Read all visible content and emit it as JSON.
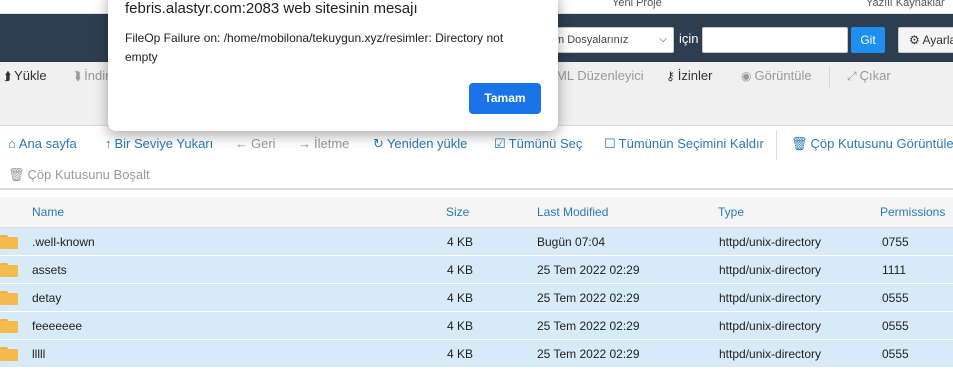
{
  "dialog": {
    "title": "febris.alastyr.com:2083 web sitesinin mesajı",
    "message": "FileOp Failure on: /home/mobilona/tekuygun.xyz/resimler: Directory not empty",
    "ok_label": "Tamam"
  },
  "bookmarks": [
    "Yeni Proje",
    "Yazılı Kaynaklar"
  ],
  "search": {
    "scope_value": "m Dosyalarınız",
    "for_label": "için",
    "query": "",
    "go_label": "Git",
    "settings_label": "Ayarlar"
  },
  "toolbar": {
    "upload": "Yükle",
    "download": "İndir",
    "html_editor": "ML Düzenleyici",
    "permissions": "İzinler",
    "view": "Görüntüle",
    "extract": "Çıkar"
  },
  "nav": {
    "home": "Ana sayfa",
    "up_one_level": "Bir Seviye Yukarı",
    "back": "Geri",
    "forward": "İletme",
    "reload": "Yeniden yükle",
    "select_all": "Tümünü Seç",
    "unselect_all": "Tümünün Seçimini Kaldır",
    "view_trash": "Çöp Kutusunu Görüntüle",
    "empty_trash": "Çöp Kutusunu Boşalt"
  },
  "table": {
    "headers": [
      "Name",
      "Size",
      "Last Modified",
      "Type",
      "Permissions"
    ],
    "rows": [
      {
        "name": ".well-known",
        "size": "4 KB",
        "modified": "Bugün 07:04",
        "type": "httpd/unix-directory",
        "perms": "0755"
      },
      {
        "name": "assets",
        "size": "4 KB",
        "modified": "25 Tem 2022 02:29",
        "type": "httpd/unix-directory",
        "perms": "1111"
      },
      {
        "name": "detay",
        "size": "4 KB",
        "modified": "25 Tem 2022 02:29",
        "type": "httpd/unix-directory",
        "perms": "0555"
      },
      {
        "name": "feeeeeee",
        "size": "4 KB",
        "modified": "25 Tem 2022 02:29",
        "type": "httpd/unix-directory",
        "perms": "0555"
      },
      {
        "name": "lllll",
        "size": "4 KB",
        "modified": "25 Tem 2022 02:29",
        "type": "httpd/unix-directory",
        "perms": "0555"
      }
    ]
  },
  "colors": {
    "header_bg": "#2d3e50",
    "row_selected": "#d6eaf8",
    "link": "#2a7ab8",
    "primary": "#1a73e8"
  }
}
